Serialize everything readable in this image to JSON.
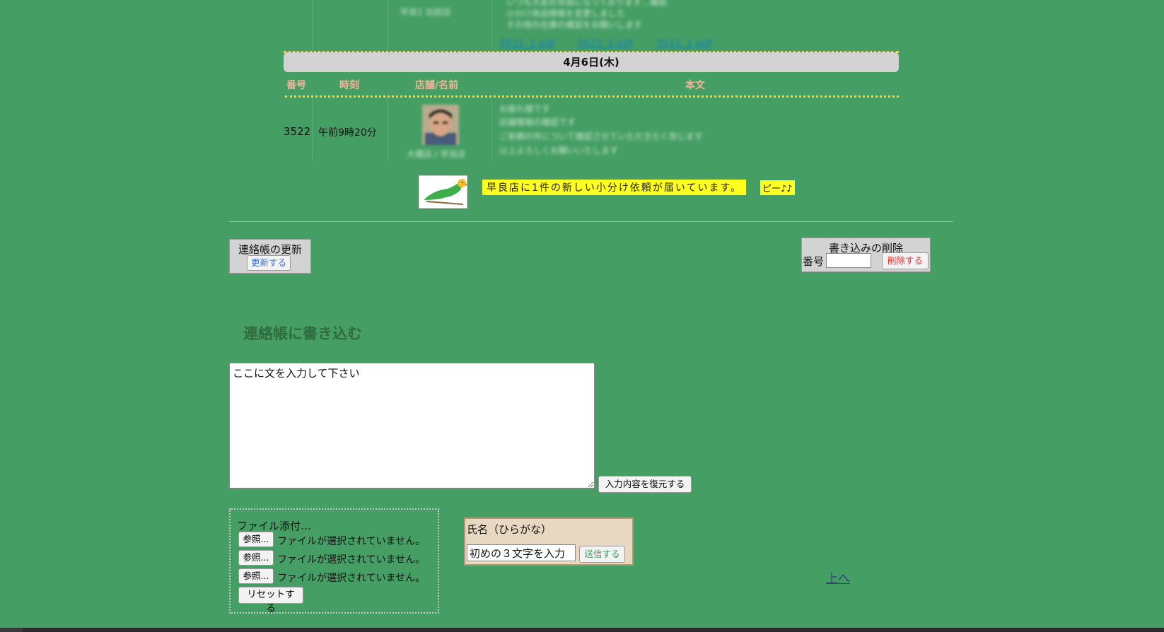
{
  "prev_entry": {
    "name": "早良1 出前店",
    "lines": [
      "いつも大変お世話になっております…確認",
      "小分け商品情報を変更しました",
      "その他の在庫の確認をお願いします"
    ],
    "attachments": [
      "3521_1.pdf",
      "3523_1.pdf",
      "3511_1.pdf"
    ]
  },
  "day_header": "4月6日(木)",
  "columns": {
    "number": "番号",
    "time": "時刻",
    "store_name": "店舗/名前",
    "body": "本文"
  },
  "entries": [
    {
      "number": "3522",
      "time": "午前9時20分",
      "name": "大橋店 / 早良店",
      "body_lines": [
        "お疲れ様です",
        "店舗情報の確認です",
        "ご依頼の件について確認させていただきたく存じます",
        "以上よろしくお願いいたします"
      ]
    }
  ],
  "notice": {
    "message": "早良店に1件の新しい小分け依頼が届いています。",
    "sound": "ピー♪♪"
  },
  "update_panel": {
    "title": "連絡帳の更新",
    "button": "更新する"
  },
  "delete_panel": {
    "title": "書き込みの削除",
    "label": "番号",
    "button": "削除する"
  },
  "compose": {
    "heading": "連絡帳に書き込む",
    "textarea_value": "ここに文を入力して下さい",
    "restore_button": "入力内容を復元する"
  },
  "attachments": {
    "title": "ファイル添付…",
    "browse_label": "参照...",
    "no_file_text": "ファイルが選択されていません。",
    "reset_button": "リセットする"
  },
  "name_form": {
    "label": "氏名（ひらがな）",
    "input_value": "初めの３文字を入力",
    "submit_button": "送信する"
  },
  "back_to_top": "上へ",
  "colors": {
    "page_background": "#459f64",
    "notice_background": "#ffff20",
    "column_header": "#f5b59a",
    "delete_button_text": "#e03030",
    "update_button_text": "#3a6fd8",
    "submit_button_text": "#3a9a5a"
  }
}
